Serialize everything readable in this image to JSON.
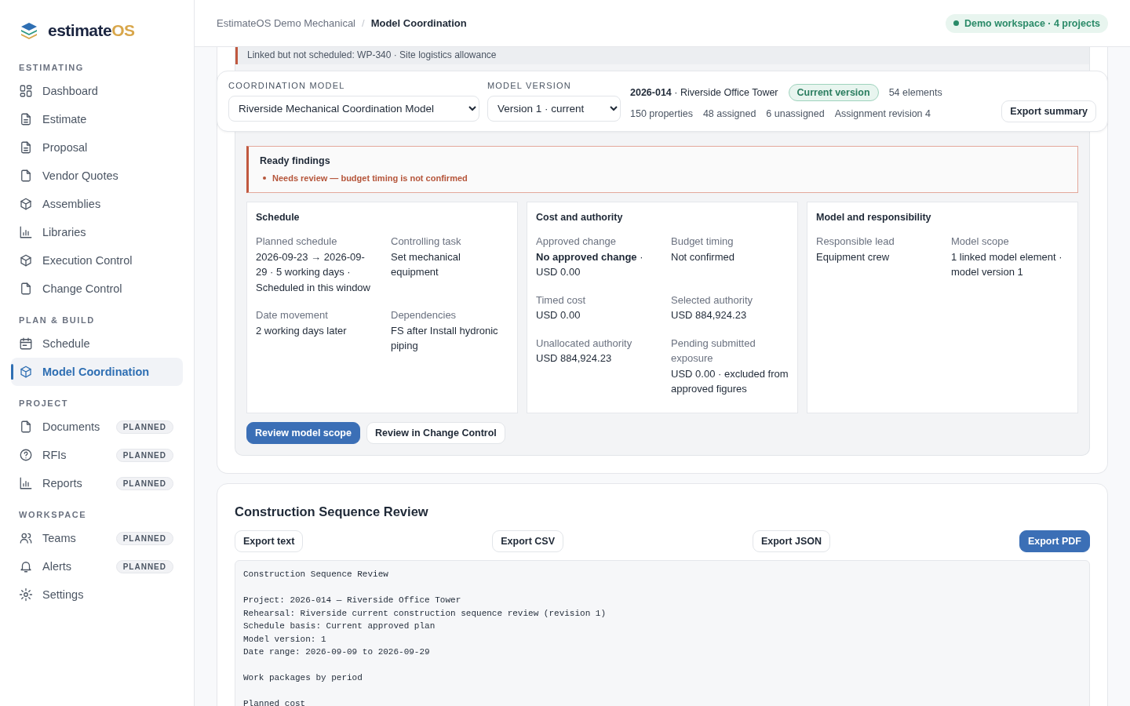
{
  "brand": {
    "name": "estimate",
    "suffix": "OS"
  },
  "sidebar": {
    "sections": [
      {
        "label": "ESTIMATING",
        "items": [
          {
            "label": "Dashboard",
            "selected": false
          },
          {
            "label": "Estimate",
            "selected": false
          },
          {
            "label": "Proposal",
            "selected": false
          },
          {
            "label": "Vendor Quotes",
            "selected": false
          },
          {
            "label": "Assemblies",
            "selected": false
          },
          {
            "label": "Libraries",
            "selected": false
          },
          {
            "label": "Execution Control",
            "selected": false
          },
          {
            "label": "Change Control",
            "selected": false
          }
        ]
      },
      {
        "label": "PLAN & BUILD",
        "items": [
          {
            "label": "Schedule",
            "selected": false
          },
          {
            "label": "Model Coordination",
            "selected": true
          }
        ]
      },
      {
        "label": "PROJECT",
        "items": [
          {
            "label": "Documents",
            "selected": false,
            "badge": "PLANNED"
          },
          {
            "label": "RFIs",
            "selected": false,
            "badge": "PLANNED"
          },
          {
            "label": "Reports",
            "selected": false,
            "badge": "PLANNED"
          }
        ]
      },
      {
        "label": "WORKSPACE",
        "items": [
          {
            "label": "Teams",
            "selected": false,
            "badge": "PLANNED"
          },
          {
            "label": "Alerts",
            "selected": false,
            "badge": "PLANNED"
          },
          {
            "label": "Settings",
            "selected": false
          }
        ]
      }
    ]
  },
  "breadcrumb": {
    "parent": "EstimateOS Demo Mechanical",
    "separator": "/",
    "current": "Model Coordination"
  },
  "workspace_badge": "Demo workspace · 4 projects",
  "linked_notice": "Linked but not scheduled: WP-340 · Site logistics allowance",
  "coordination": {
    "model_label": "COORDINATION MODEL",
    "model_value": "Riverside Mechanical Coordination Model",
    "version_label": "MODEL VERSION",
    "version_value": "Version 1 · current",
    "project": "**2026-014** · Riverside Office Tower",
    "version_badge": "Current version",
    "elements": "54 elements",
    "stats": [
      "150 properties",
      "48 assigned",
      "6 unassigned",
      "Assignment revision 4"
    ],
    "export": "Export summary"
  },
  "findings": {
    "title": "Ready findings",
    "items": [
      "Needs review — budget timing is not confirmed"
    ]
  },
  "cards": [
    {
      "title": "Schedule",
      "fields": [
        {
          "label": "Planned schedule",
          "value": "2026-09-23 → 2026-09-29 · 5 working days · Scheduled in this window"
        },
        {
          "label": "Controlling task",
          "value": "Set mechanical equipment"
        },
        {
          "label": "Date movement",
          "value": "2 working days later"
        },
        {
          "label": "Dependencies",
          "value": "FS after Install hydronic piping"
        }
      ]
    },
    {
      "title": "Cost and authority",
      "fields": [
        {
          "label": "Approved change",
          "value": "**No approved change** · USD 0.00"
        },
        {
          "label": "Budget timing",
          "value": "Not confirmed"
        },
        {
          "label": "Timed cost",
          "value": "USD 0.00"
        },
        {
          "label": "Selected authority",
          "value": "USD 884,924.23"
        },
        {
          "label": "Unallocated authority",
          "value": "USD 884,924.23"
        },
        {
          "label": "Pending submitted exposure",
          "value": "USD 0.00 · excluded from approved figures"
        }
      ]
    },
    {
      "title": "Model and responsibility",
      "fields": [
        {
          "label": "Responsible lead",
          "value": "Equipment crew"
        },
        {
          "label": "Model scope",
          "value": "1 linked model element · model version 1"
        }
      ]
    }
  ],
  "actions": [
    {
      "label": "Review model scope",
      "kind": "primary"
    },
    {
      "label": "Review in Change Control",
      "kind": "secondary"
    }
  ],
  "sequence": {
    "title": "Construction Sequence Review",
    "exports": [
      {
        "label": "Export text",
        "kind": "secondary"
      },
      {
        "label": "Export CSV",
        "kind": "secondary"
      },
      {
        "label": "Export JSON",
        "kind": "secondary"
      },
      {
        "label": "Export PDF",
        "kind": "primary"
      }
    ],
    "paragraphs": [
      [
        "Construction Sequence Review"
      ],
      [
        "Project: 2026-014 — Riverside Office Tower",
        "Rehearsal: Riverside current construction sequence review (revision 1)",
        "Schedule basis: Current approved plan",
        "Model version: 1",
        "Date range: 2026-09-09 to 2026-09-29"
      ],
      [
        "Work packages by period"
      ],
      [
        "Planned cost"
      ]
    ]
  }
}
